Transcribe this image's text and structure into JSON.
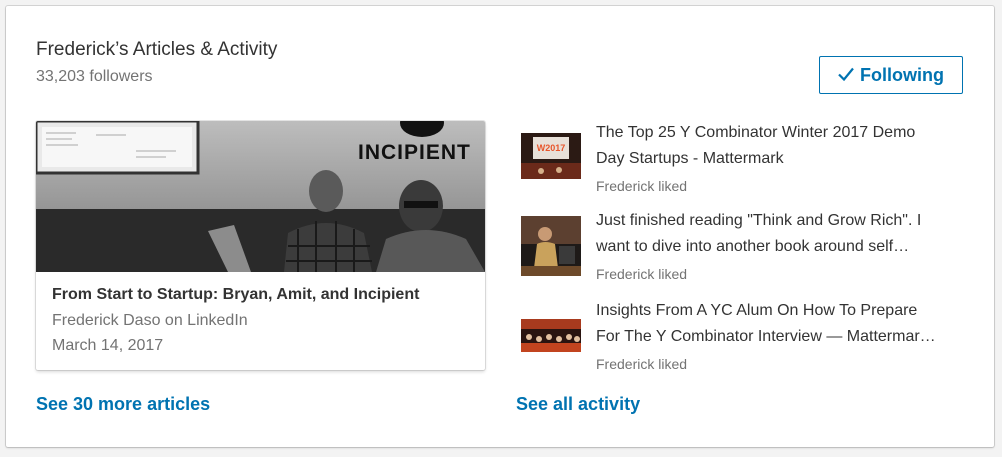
{
  "header": {
    "title": "Frederick’s Articles & Activity",
    "followers": "33,203 followers",
    "follow_button": "Following"
  },
  "article": {
    "hero_sign_text": "INCIPIENT",
    "title": "From Start to Startup: Bryan, Amit, and Incipient",
    "author": "Frederick Daso on LinkedIn",
    "date": "March 14, 2017"
  },
  "activity": [
    {
      "title_line1": "The Top 25 Y Combinator Winter 2017 Demo",
      "title_line2": "Day Startups - Mattermark",
      "subtitle": "Frederick liked",
      "thumb_text": "W2017"
    },
    {
      "title_line1": "Just finished reading \"Think and Grow Rich\". I",
      "title_line2": "want to dive into another book around self…",
      "subtitle": "Frederick liked"
    },
    {
      "title_line1": "Insights From A YC Alum On How To Prepare",
      "title_line2": "For The Y Combinator Interview — Mattermar…",
      "subtitle": "Frederick liked"
    }
  ],
  "footer": {
    "more_articles": "See 30 more articles",
    "all_activity": "See all activity"
  },
  "colors": {
    "accent": "#0073b1",
    "muted": "#737373",
    "text": "#333333"
  },
  "icons": {
    "follow_check": "checkmark-icon"
  }
}
